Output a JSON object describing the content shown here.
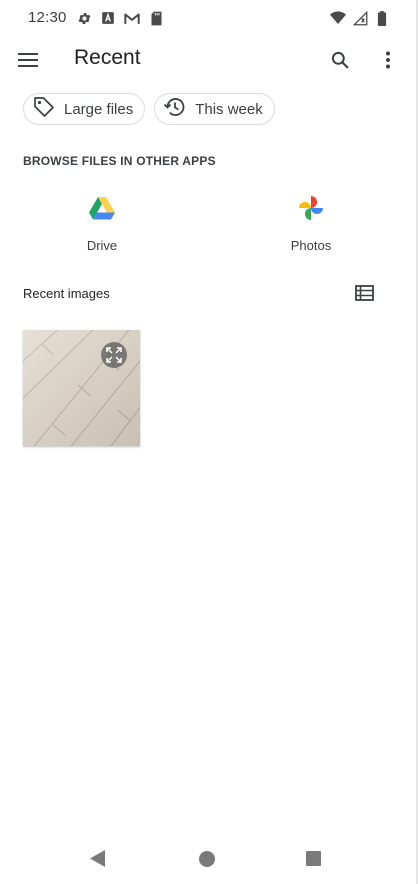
{
  "status_bar": {
    "time": "12:30",
    "left_icons": [
      "settings-icon",
      "text-a-icon",
      "gmail-icon",
      "sd-card-icon"
    ],
    "right_icons": [
      "wifi-icon",
      "signal-icon",
      "battery-icon"
    ]
  },
  "app_bar": {
    "title": "Recent"
  },
  "chips": [
    {
      "label": "Large files",
      "icon": "tag-icon"
    },
    {
      "label": "This week",
      "icon": "history-icon"
    }
  ],
  "browse": {
    "heading": "BROWSE FILES IN OTHER APPS",
    "apps": [
      {
        "name": "Drive",
        "icon": "google-drive-icon"
      },
      {
        "name": "Photos",
        "icon": "google-photos-icon"
      }
    ]
  },
  "recent_images": {
    "heading": "Recent images"
  },
  "nav_bar": {
    "buttons": [
      "back",
      "home",
      "recents"
    ]
  },
  "colors": {
    "drive_green": "#1fa463",
    "drive_yellow": "#ffd04b",
    "drive_blue": "#4688f1",
    "photos_red": "#ea4335",
    "photos_yellow": "#fbbc05",
    "photos_green": "#34a853",
    "photos_blue": "#4285f4"
  }
}
